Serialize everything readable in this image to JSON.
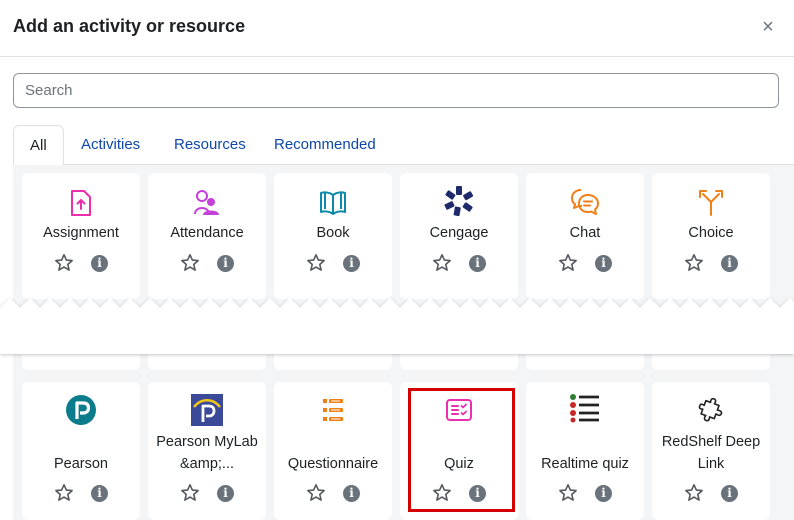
{
  "dialog": {
    "title": "Add an activity or resource",
    "close_glyph": "×"
  },
  "search": {
    "placeholder": "Search",
    "value": ""
  },
  "tabs": [
    {
      "label": "All",
      "active": true
    },
    {
      "label": "Activities",
      "active": false
    },
    {
      "label": "Resources",
      "active": false
    },
    {
      "label": "Recommended",
      "active": false
    }
  ],
  "top_row": [
    {
      "label": "Assignment",
      "icon": "assignment-icon",
      "color": "#eb2eaf"
    },
    {
      "label": "Attendance",
      "icon": "attendance-icon",
      "color": "#c53fd9"
    },
    {
      "label": "Book",
      "icon": "book-icon",
      "color": "#0d8aa9"
    },
    {
      "label": "Cengage",
      "icon": "cengage-icon",
      "color": "#1f2a6b"
    },
    {
      "label": "Chat",
      "icon": "chat-icon",
      "color": "#f07f18"
    },
    {
      "label": "Choice",
      "icon": "choice-icon",
      "color": "#f07f18"
    }
  ],
  "bottom_row": [
    {
      "label": "Pearson",
      "icon": "pearson-icon",
      "color": "#0a7c8c"
    },
    {
      "label": "Pearson MyLab &amp;...",
      "icon": "pearson-mylab-icon",
      "color": "#3a4a99"
    },
    {
      "label": "Questionnaire",
      "icon": "questionnaire-icon",
      "color": "#f07f18"
    },
    {
      "label": "Quiz",
      "icon": "quiz-icon",
      "color": "#eb2eaf"
    },
    {
      "label": "Realtime quiz",
      "icon": "realtime-quiz-icon",
      "color": "#222222"
    },
    {
      "label": "RedShelf Deep Link",
      "icon": "redshelf-icon",
      "color": "#222222"
    }
  ],
  "card_actions": {
    "info_glyph": "i"
  },
  "colors": {
    "link": "#0f47ad",
    "panel_bg": "#f4f5f7",
    "highlight": "#d40000",
    "info_bg": "#6a737b"
  }
}
